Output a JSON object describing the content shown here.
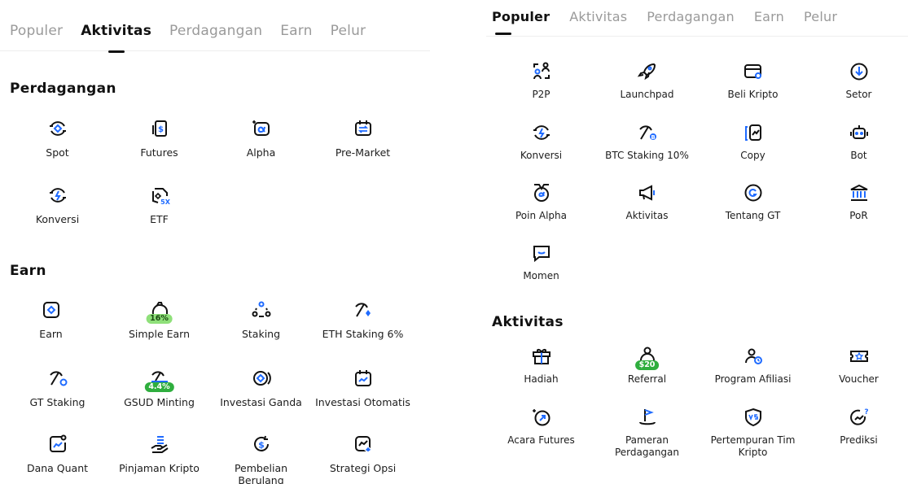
{
  "left": {
    "tabs": [
      "Populer",
      "Aktivitas",
      "Perdagangan",
      "Earn",
      "Pelur"
    ],
    "active_tab": 1,
    "sections": {
      "perdagangan": {
        "title": "Perdagangan",
        "items": [
          {
            "label": "Spot",
            "icon": "spot-icon"
          },
          {
            "label": "Futures",
            "icon": "futures-icon"
          },
          {
            "label": "Alpha",
            "icon": "alpha-icon"
          },
          {
            "label": "Pre-Market",
            "icon": "pre-market-icon"
          },
          {
            "label": "Konversi",
            "icon": "convert-icon"
          },
          {
            "label": "ETF",
            "icon": "etf-icon"
          }
        ]
      },
      "earn": {
        "title": "Earn",
        "items": [
          {
            "label": "Earn",
            "icon": "earn-icon"
          },
          {
            "label": "Simple Earn",
            "icon": "piggy-icon",
            "badge": "16%"
          },
          {
            "label": "Staking",
            "icon": "staking-icon"
          },
          {
            "label": "ETH Staking 6%",
            "icon": "pickaxe-icon"
          },
          {
            "label": "GT Staking",
            "icon": "pickaxe-gt-icon"
          },
          {
            "label": "GSUD Minting",
            "icon": "mint-icon",
            "badge": "4.4%"
          },
          {
            "label": "Investasi Ganda",
            "icon": "dual-invest-icon"
          },
          {
            "label": "Investasi Otomatis",
            "icon": "auto-invest-icon"
          },
          {
            "label": "Dana Quant",
            "icon": "quant-fund-icon"
          },
          {
            "label": "Pinjaman Kripto",
            "icon": "loan-icon"
          },
          {
            "label": "Pembelian Berulang",
            "icon": "recurring-buy-icon"
          },
          {
            "label": "Strategi Opsi",
            "icon": "options-strategy-icon"
          }
        ]
      }
    }
  },
  "right": {
    "tabs": [
      "Populer",
      "Aktivitas",
      "Perdagangan",
      "Earn",
      "Pelur"
    ],
    "active_tab": 0,
    "populer_items": [
      {
        "label": "P2P",
        "icon": "p2p-icon"
      },
      {
        "label": "Launchpad",
        "icon": "rocket-icon"
      },
      {
        "label": "Beli Kripto",
        "icon": "buy-crypto-icon"
      },
      {
        "label": "Setor",
        "icon": "deposit-icon"
      },
      {
        "label": "Konversi",
        "icon": "convert-icon"
      },
      {
        "label": "BTC Staking 10%",
        "icon": "btc-pickaxe-icon"
      },
      {
        "label": "Copy",
        "icon": "copy-trade-icon"
      },
      {
        "label": "Bot",
        "icon": "bot-icon"
      },
      {
        "label": "Poin Alpha",
        "icon": "alpha-medal-icon"
      },
      {
        "label": "Aktivitas",
        "icon": "megaphone-icon"
      },
      {
        "label": "Tentang GT",
        "icon": "gt-coin-icon"
      },
      {
        "label": "PoR",
        "icon": "bank-icon"
      },
      {
        "label": "Momen",
        "icon": "chat-icon"
      }
    ],
    "aktivitas": {
      "title": "Aktivitas",
      "items": [
        {
          "label": "Hadiah",
          "icon": "gift-icon"
        },
        {
          "label": "Referral",
          "icon": "referral-icon",
          "badge": "$20"
        },
        {
          "label": "Program Afiliasi",
          "icon": "affiliate-icon"
        },
        {
          "label": "Voucher",
          "icon": "voucher-icon"
        },
        {
          "label": "Acara Futures",
          "icon": "futures-event-icon"
        },
        {
          "label": "Pameran Perdagangan",
          "icon": "flag-icon"
        },
        {
          "label": "Pertempuran Tim Kripto",
          "icon": "shield-vs-icon"
        },
        {
          "label": "Prediksi",
          "icon": "prediction-icon"
        }
      ]
    }
  },
  "colors": {
    "accent": "#1f6bff",
    "badge_green": "#8fe07a",
    "text": "#1a1a1a",
    "tab_inactive": "#9a9a9a"
  }
}
